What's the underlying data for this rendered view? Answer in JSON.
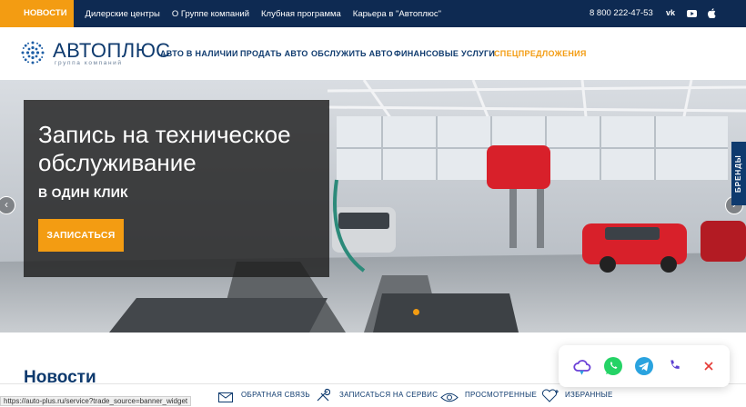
{
  "topbar": {
    "news_label": "НОВОСТИ",
    "links": [
      "Дилерские центры",
      "О Группе компаний",
      "Клубная программа",
      "Карьера в \"Автоплюс\""
    ],
    "phone": "8 800 222-47-53",
    "social": [
      "vk-icon",
      "youtube-icon",
      "apple-icon"
    ],
    "vk_text": "vk"
  },
  "header": {
    "logo_text": "АВТОПЛЮС",
    "logo_sub": "группа компаний",
    "nav": [
      "АВТО В НАЛИЧИИ",
      "ПРОДАТЬ АВТО",
      "ОБСЛУЖИТЬ АВТО",
      "ФИНАНСОВЫЕ УСЛУГИ",
      "СПЕЦПРЕДЛОЖЕНИЯ"
    ]
  },
  "hero": {
    "title": "Запись на техническое обслуживание",
    "subtitle": "В ОДИН КЛИК",
    "button": "ЗАПИСАТЬСЯ",
    "brands_tab": "БРЕНДЫ",
    "slide_count": 1,
    "active_slide": 1
  },
  "news": {
    "title": "Новости"
  },
  "bottombar": {
    "items": [
      "ОБРАТНАЯ СВЯЗЬ",
      "ЗАПИСАТЬСЯ НА СЕРВИС",
      "ПРОСМОТРЕННЫЕ",
      "ИЗБРАННЫЕ"
    ]
  },
  "status_url": "https://auto-plus.ru/service?trade_source=banner_widget",
  "contacts": {
    "icons": [
      "cloud-chat-icon",
      "whatsapp-icon",
      "telegram-icon",
      "phone-icon",
      "close-icon"
    ]
  },
  "colors": {
    "navy": "#0e2a52",
    "brand_blue": "#0e3a6e",
    "accent_orange": "#f39c12",
    "whatsapp": "#25d366",
    "telegram": "#2aa3df",
    "phone": "#5b3fd1",
    "close": "#e53935"
  }
}
